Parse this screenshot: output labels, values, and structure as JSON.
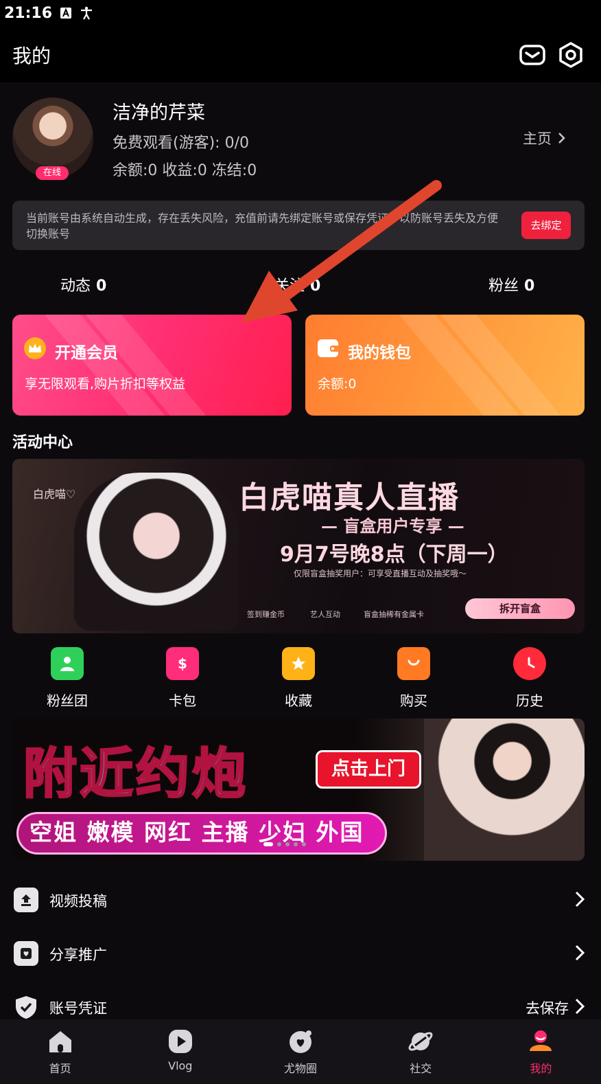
{
  "status_bar": {
    "time": "21:16"
  },
  "app_bar": {
    "title": "我的",
    "icons": [
      "message-icon",
      "settings-icon"
    ]
  },
  "profile": {
    "nickname": "洁净的芹菜",
    "free_watch": "免费观看(游客): 0/0",
    "balances": "余额:0 收益:0 冻结:0",
    "online_badge": "在线",
    "homepage_link": "主页"
  },
  "notice": {
    "text": "当前账号由系统自动生成，存在丢失风险，充值前请先绑定账号或保存凭证，以防账号丢失及方便切换账号",
    "button": "去绑定"
  },
  "stats": [
    {
      "label": "动态",
      "value": "0"
    },
    {
      "label": "关注",
      "value": "0"
    },
    {
      "label": "粉丝",
      "value": "0"
    }
  ],
  "cards": {
    "vip": {
      "title": "开通会员",
      "subtitle": "享无限观看,购片折扣等权益",
      "icon": "crown-icon"
    },
    "wallet": {
      "title": "我的钱包",
      "subtitle": "余额:0",
      "icon": "wallet-icon"
    }
  },
  "activity": {
    "section_title": "活动中心",
    "banner1": {
      "handwriting": "白虎喵♡",
      "heading": "白虎喵真人直播",
      "subheading": "— 盲盒用户专享 —",
      "date": "9月7号晚8点（下周一）",
      "note": "仅限盲盒抽奖用户：可享受直播互动及抽奖哦～",
      "features": [
        "签到赚金币",
        "艺人互动",
        "盲盒抽稀有金属卡"
      ],
      "cta": "拆开盲盒"
    }
  },
  "shortcuts": [
    {
      "label": "粉丝团",
      "icon": "fan-group-icon",
      "color": "#2fd05a"
    },
    {
      "label": "卡包",
      "icon": "card-pack-icon",
      "color": "#ff2d7a"
    },
    {
      "label": "收藏",
      "icon": "favorite-icon",
      "color": "#ffb218"
    },
    {
      "label": "购买",
      "icon": "shopping-bag-icon",
      "color": "#ff7a22"
    },
    {
      "label": "历史",
      "icon": "history-icon",
      "color": "#ff2a3a"
    }
  ],
  "banner2": {
    "headline": "附近约炮",
    "button": "点击上门",
    "tags": "空姐 嫩模 网红 主播 少妇 外国",
    "dots_total": 5,
    "dots_active": 1
  },
  "list": [
    {
      "label": "视频投稿",
      "icon": "upload-icon",
      "value": ""
    },
    {
      "label": "分享推广",
      "icon": "share-icon",
      "value": ""
    },
    {
      "label": "账号凭证",
      "icon": "shield-icon",
      "value": "去保存"
    }
  ],
  "bottom_nav": [
    {
      "label": "首页",
      "icon": "home-icon",
      "active": false
    },
    {
      "label": "Vlog",
      "icon": "play-icon",
      "active": false
    },
    {
      "label": "尤物圈",
      "icon": "heart-circle-icon",
      "active": false
    },
    {
      "label": "社交",
      "icon": "planet-icon",
      "active": false
    },
    {
      "label": "我的",
      "icon": "profile-icon",
      "active": true
    }
  ],
  "colors": {
    "accent": "#ff2d6e",
    "background": "#0d0a0e",
    "annotation_arrow": "#e0452e"
  }
}
